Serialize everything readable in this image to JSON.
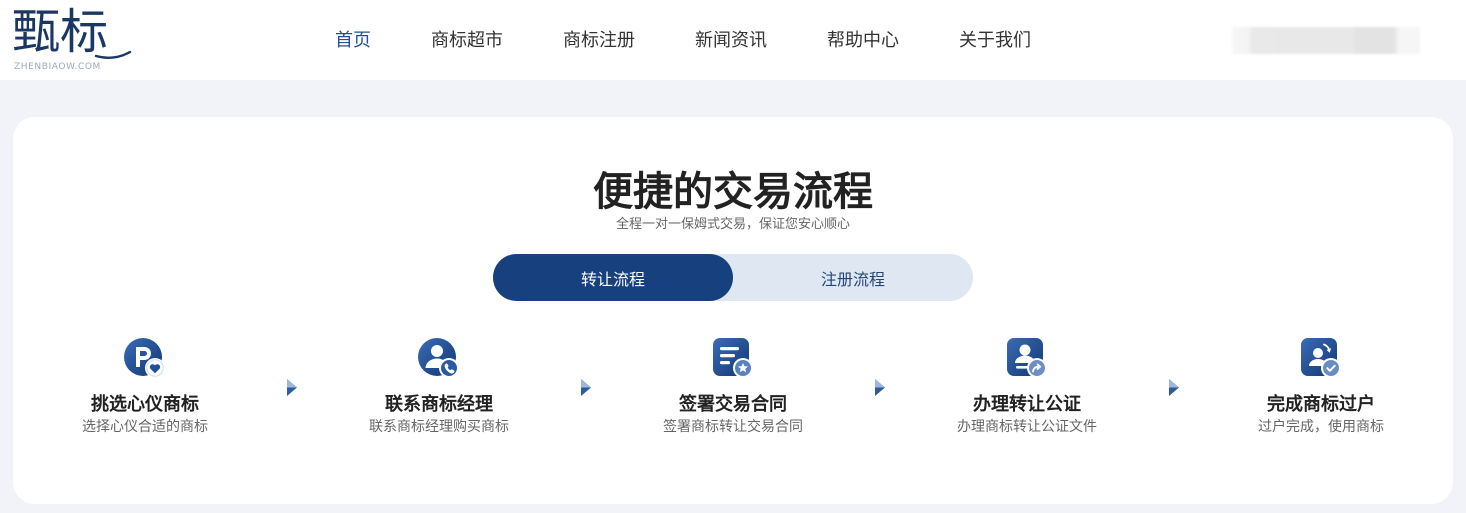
{
  "header": {
    "logo": {
      "text": "甄标",
      "subtext": "ZHENBIAOW.COM"
    },
    "nav": [
      {
        "label": "首页",
        "active": true
      },
      {
        "label": "商标超市",
        "active": false
      },
      {
        "label": "商标注册",
        "active": false
      },
      {
        "label": "新闻资讯",
        "active": false
      },
      {
        "label": "帮助中心",
        "active": false
      },
      {
        "label": "关于我们",
        "active": false
      }
    ]
  },
  "process": {
    "title": "便捷的交易流程",
    "subtitle": "全程一对一保姆式交易，保证您安心顺心",
    "tabs": [
      {
        "label": "转让流程",
        "active": true
      },
      {
        "label": "注册流程",
        "active": false
      }
    ],
    "steps": [
      {
        "icon": "trademark-heart-icon",
        "title": "挑选心仪商标",
        "desc": "选择心仪合适的商标"
      },
      {
        "icon": "manager-phone-icon",
        "title": "联系商标经理",
        "desc": "联系商标经理购买商标"
      },
      {
        "icon": "contract-star-icon",
        "title": "签署交易合同",
        "desc": "签署商标转让交易合同"
      },
      {
        "icon": "notary-certificate-icon",
        "title": "办理转让公证",
        "desc": "办理商标转让公证文件"
      },
      {
        "icon": "transfer-complete-icon",
        "title": "完成商标过户",
        "desc": "过户完成，使用商标"
      }
    ],
    "arrow_icon": "chevron-right-icon"
  },
  "colors": {
    "primary": "#17407e",
    "primary_light": "#dfe7f3",
    "nav_active": "#24508f",
    "page_bg": "#f1f3f8",
    "text_dark": "#222222",
    "text_muted": "#666666"
  }
}
